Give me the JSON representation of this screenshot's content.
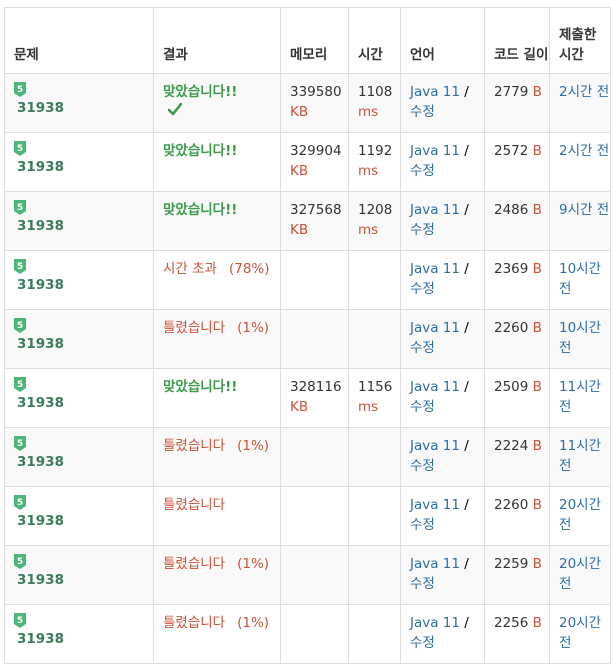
{
  "headers": {
    "problem": "문제",
    "result": "결과",
    "memory": "메모리",
    "time": "시간",
    "language": "언어",
    "code_length": "코드 길이",
    "submitted": "제출한 시간"
  },
  "tier_label": "5",
  "icons": {
    "tier": "tier-badge-icon",
    "check": "checkmark-icon"
  },
  "colors": {
    "accepted": "#3c9a4b",
    "wrong": "#c9533b",
    "link": "#2e6da4",
    "problem_id": "#3c7b5b"
  },
  "rows": [
    {
      "problem_id": "31938",
      "result": "맞았습니다!!",
      "result_type": "ac",
      "check": true,
      "percent": "",
      "memory": "339580",
      "memory_unit": "KB",
      "time": "1108",
      "time_unit": "ms",
      "lang": "Java 11",
      "edit": "수정",
      "code_len": "2779",
      "code_unit": "B",
      "submitted": "2시간 전"
    },
    {
      "problem_id": "31938",
      "result": "맞았습니다!!",
      "result_type": "ac",
      "check": false,
      "percent": "",
      "memory": "329904",
      "memory_unit": "KB",
      "time": "1192",
      "time_unit": "ms",
      "lang": "Java 11",
      "edit": "수정",
      "code_len": "2572",
      "code_unit": "B",
      "submitted": "2시간 전"
    },
    {
      "problem_id": "31938",
      "result": "맞았습니다!!",
      "result_type": "ac",
      "check": false,
      "percent": "",
      "memory": "327568",
      "memory_unit": "KB",
      "time": "1208",
      "time_unit": "ms",
      "lang": "Java 11",
      "edit": "수정",
      "code_len": "2486",
      "code_unit": "B",
      "submitted": "9시간 전"
    },
    {
      "problem_id": "31938",
      "result": "시간 초과",
      "result_type": "tle",
      "check": false,
      "percent": "(78%)",
      "memory": "",
      "memory_unit": "",
      "time": "",
      "time_unit": "",
      "lang": "Java 11",
      "edit": "수정",
      "code_len": "2369",
      "code_unit": "B",
      "submitted": "10시간 전"
    },
    {
      "problem_id": "31938",
      "result": "틀렸습니다",
      "result_type": "wa",
      "check": false,
      "percent": "(1%)",
      "memory": "",
      "memory_unit": "",
      "time": "",
      "time_unit": "",
      "lang": "Java 11",
      "edit": "수정",
      "code_len": "2260",
      "code_unit": "B",
      "submitted": "10시간 전"
    },
    {
      "problem_id": "31938",
      "result": "맞았습니다!!",
      "result_type": "ac",
      "check": false,
      "percent": "",
      "memory": "328116",
      "memory_unit": "KB",
      "time": "1156",
      "time_unit": "ms",
      "lang": "Java 11",
      "edit": "수정",
      "code_len": "2509",
      "code_unit": "B",
      "submitted": "11시간 전"
    },
    {
      "problem_id": "31938",
      "result": "틀렸습니다",
      "result_type": "wa",
      "check": false,
      "percent": "(1%)",
      "memory": "",
      "memory_unit": "",
      "time": "",
      "time_unit": "",
      "lang": "Java 11",
      "edit": "수정",
      "code_len": "2224",
      "code_unit": "B",
      "submitted": "11시간 전"
    },
    {
      "problem_id": "31938",
      "result": "틀렸습니다",
      "result_type": "wa",
      "check": false,
      "percent": "",
      "memory": "",
      "memory_unit": "",
      "time": "",
      "time_unit": "",
      "lang": "Java 11",
      "edit": "수정",
      "code_len": "2260",
      "code_unit": "B",
      "submitted": "20시간 전"
    },
    {
      "problem_id": "31938",
      "result": "틀렸습니다",
      "result_type": "wa",
      "check": false,
      "percent": "(1%)",
      "memory": "",
      "memory_unit": "",
      "time": "",
      "time_unit": "",
      "lang": "Java 11",
      "edit": "수정",
      "code_len": "2259",
      "code_unit": "B",
      "submitted": "20시간 전"
    },
    {
      "problem_id": "31938",
      "result": "틀렸습니다",
      "result_type": "wa",
      "check": false,
      "percent": "(1%)",
      "memory": "",
      "memory_unit": "",
      "time": "",
      "time_unit": "",
      "lang": "Java 11",
      "edit": "수정",
      "code_len": "2256",
      "code_unit": "B",
      "submitted": "20시간 전"
    }
  ]
}
